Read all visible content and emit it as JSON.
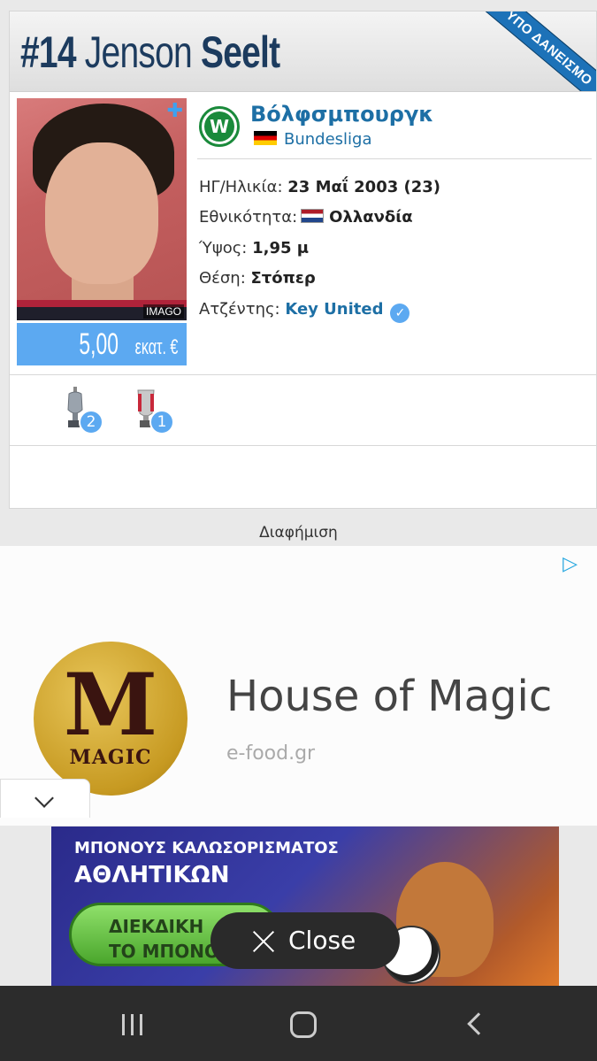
{
  "player": {
    "number": "#14",
    "first_name": "Jenson",
    "last_name": "Seelt",
    "loan_ribbon": "ΥΠΟ ΔΑΝΕΙΣΜΟ",
    "photo_credit": "IMAGO",
    "market_value": "5,00",
    "market_value_unit": "εκατ. €"
  },
  "club": {
    "logo_letter": "W",
    "name": "Βόλφσμπουργκ",
    "league": "Bundesliga"
  },
  "details": {
    "birth_label": "ΗΓ/Ηλικία:",
    "birth_value": "23 Μαΐ 2003 (23)",
    "nationality_label": "Εθνικότητα:",
    "nationality_value": "Ολλανδία",
    "height_label": "Ύψος:",
    "height_value": "1,95 μ",
    "position_label": "Θέση:",
    "position_value": "Στόπερ",
    "agent_label": "Ατζέντης:",
    "agent_value": "Key United"
  },
  "trophies": [
    {
      "count": "2"
    },
    {
      "count": "1"
    }
  ],
  "ad": {
    "label": "Διαφήμιση",
    "brand_logo_word": "MAGIC",
    "brand_logo_letter": "M",
    "title": "House of Magic",
    "domain": "e-food.gr"
  },
  "banner": {
    "line1": "ΜΠΟΝΟΥΣ ΚΑΛΩΣΟΡΙΣΜΑΤΟΣ",
    "line2": "ΑΘΛΗΤΙΚΩΝ",
    "cta": "ΔΙΕΚΔΙΚΗ\nΤΟ ΜΠΟΝΟ"
  },
  "close_button": "Close",
  "colors": {
    "header_text": "#1c3b5e",
    "link": "#1d6fa5",
    "value_bg": "#5ca9f1",
    "ribbon": "#1d72b8"
  }
}
